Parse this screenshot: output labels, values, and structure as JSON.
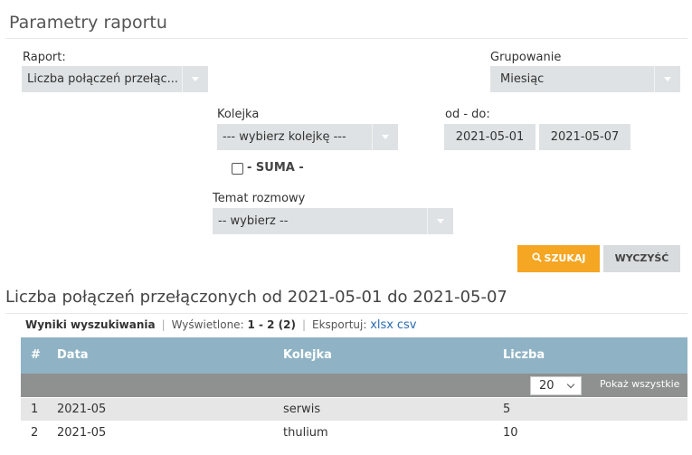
{
  "page": {
    "title": "Parametry raportu"
  },
  "form": {
    "raport": {
      "label": "Raport:",
      "value": "Liczba połączeń przełąc..."
    },
    "grupowanie": {
      "label": "Grupowanie",
      "value": "Miesiąc"
    },
    "kolejka": {
      "label": "Kolejka",
      "value": "--- wybierz kolejkę ---"
    },
    "suma": {
      "label": "- SUMA -",
      "checked": false
    },
    "daterange": {
      "label": "od - do:",
      "from": "2021-05-01",
      "to": "2021-05-07"
    },
    "temat": {
      "label": "Temat rozmowy",
      "value": "-- wybierz --"
    },
    "search_button": "SZUKAJ",
    "clear_button": "WYCZYŚĆ",
    "search_icon": "search-icon"
  },
  "results": {
    "heading": "Liczba połączeń przełączonych od 2021-05-01 do 2021-05-07",
    "tab_label": "Wyniki wyszukiwania",
    "displayed_label": "Wyświetlone:",
    "displayed_value": "1 - 2 (2)",
    "export_label": "Eksportuj:",
    "export_xlsx": "xlsx",
    "export_csv": "csv",
    "columns": [
      "#",
      "Data",
      "Kolejka",
      "Liczba"
    ],
    "per_page": "20",
    "show_all": "Pokaż wszystkie",
    "rows": [
      {
        "num": "1",
        "data": "2021-05",
        "kolejka": "serwis",
        "liczba": "5"
      },
      {
        "num": "2",
        "data": "2021-05",
        "kolejka": "thulium",
        "liczba": "10"
      }
    ]
  },
  "colors": {
    "accent": "#f5a623",
    "header": "#8fb3c4",
    "toolbar": "#8f9090",
    "select": "#dfe2e4"
  }
}
